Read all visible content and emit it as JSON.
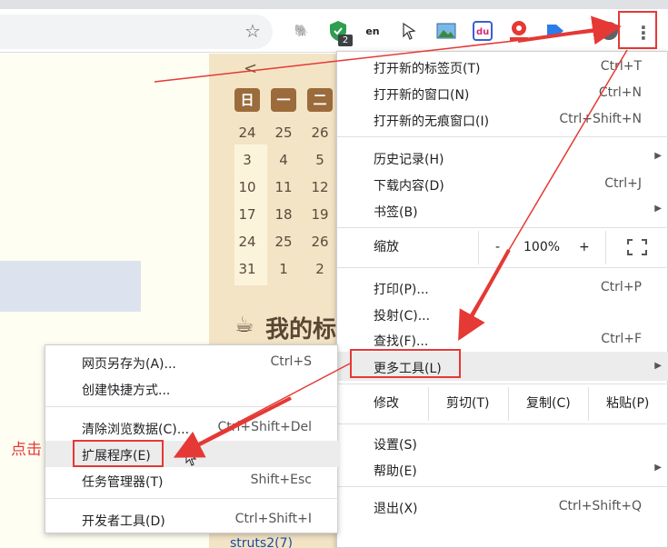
{
  "toolbar": {
    "badge_count": "2",
    "menu_icon": "kebab-menu-icon"
  },
  "calendar": {
    "nav": "<",
    "headers": [
      "日",
      "一",
      "二"
    ],
    "rows": [
      [
        "24",
        "25",
        "26"
      ],
      [
        "3",
        "4",
        "5"
      ],
      [
        "10",
        "11",
        "12"
      ],
      [
        "17",
        "18",
        "19"
      ],
      [
        "24",
        "25",
        "26"
      ],
      [
        "31",
        "1",
        "2"
      ]
    ]
  },
  "page": {
    "section_title": "我的标",
    "link_text": "struts2(7)"
  },
  "main_menu": {
    "new_tab": {
      "label": "打开新的标签页(T)",
      "shortcut": "Ctrl+T"
    },
    "new_window": {
      "label": "打开新的窗口(N)",
      "shortcut": "Ctrl+N"
    },
    "new_incognito": {
      "label": "打开新的无痕窗口(I)",
      "shortcut": "Ctrl+Shift+N"
    },
    "history": {
      "label": "历史记录(H)"
    },
    "downloads": {
      "label": "下载内容(D)",
      "shortcut": "Ctrl+J"
    },
    "bookmarks": {
      "label": "书签(B)"
    },
    "zoom": {
      "label": "缩放",
      "minus": "-",
      "value": "100%",
      "plus": "+"
    },
    "print": {
      "label": "打印(P)...",
      "shortcut": "Ctrl+P"
    },
    "cast": {
      "label": "投射(C)..."
    },
    "find": {
      "label": "查找(F)...",
      "shortcut": "Ctrl+F"
    },
    "more_tools": {
      "label": "更多工具(L)"
    },
    "edit": {
      "label": "修改",
      "cut": "剪切(T)",
      "copy": "复制(C)",
      "paste": "粘贴(P)"
    },
    "settings": {
      "label": "设置(S)"
    },
    "help": {
      "label": "帮助(E)"
    },
    "exit": {
      "label": "退出(X)",
      "shortcut": "Ctrl+Shift+Q"
    }
  },
  "sub_menu": {
    "save_page": {
      "label": "网页另存为(A)...",
      "shortcut": "Ctrl+S"
    },
    "create_shortcut": {
      "label": "创建快捷方式..."
    },
    "clear_data": {
      "label": "清除浏览数据(C)...",
      "shortcut": "Ctrl+Shift+Del"
    },
    "extensions": {
      "label": "扩展程序(E)"
    },
    "task_manager": {
      "label": "任务管理器(T)",
      "shortcut": "Shift+Esc"
    },
    "dev_tools": {
      "label": "开发者工具(D)",
      "shortcut": "Ctrl+Shift+I"
    }
  },
  "annotation": {
    "click_note": "点击"
  },
  "colors": {
    "annotation_red": "#e53935",
    "calendar_bg": "#f3e4c6",
    "calendar_header": "#9c6b3c"
  }
}
